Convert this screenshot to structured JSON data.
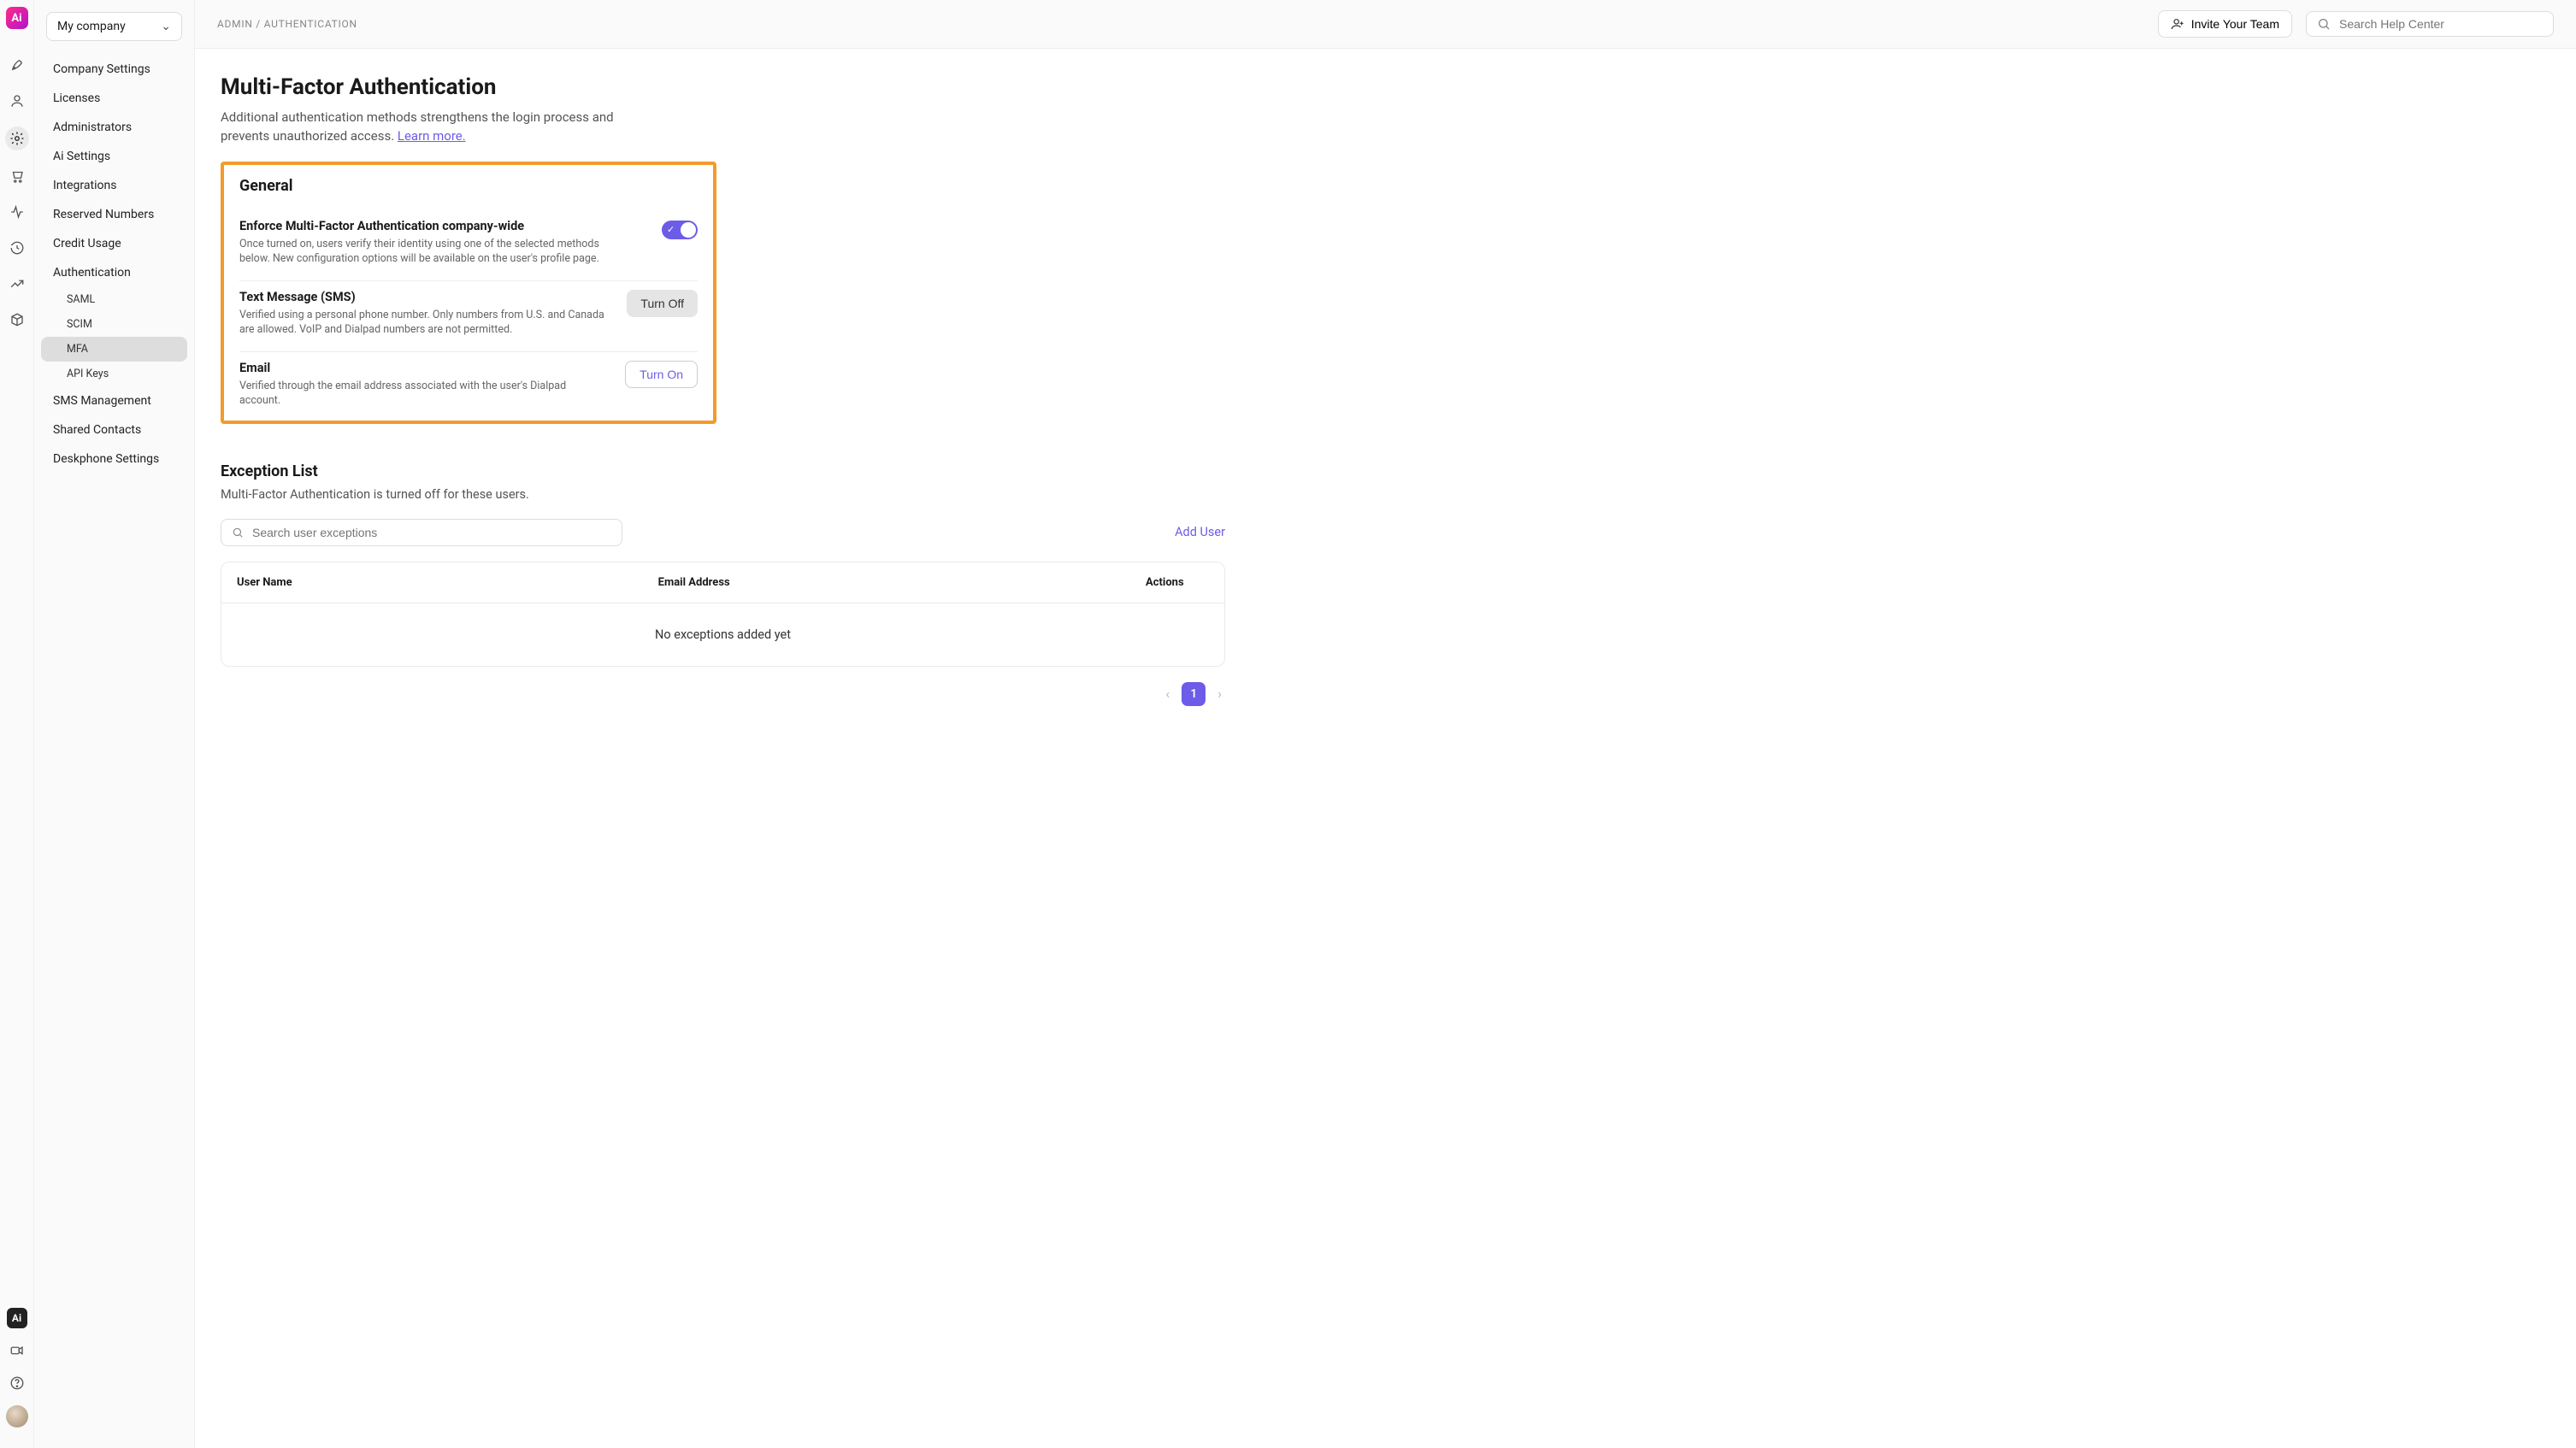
{
  "brand_initial": "Ai",
  "company_selector": {
    "label": "My company"
  },
  "sidebar": {
    "items": [
      "Company Settings",
      "Licenses",
      "Administrators",
      "Ai Settings",
      "Integrations",
      "Reserved Numbers",
      "Credit Usage",
      "Authentication"
    ],
    "auth_sub": [
      "SAML",
      "SCIM",
      "MFA",
      "API Keys"
    ],
    "auth_sub_active": "MFA",
    "items_after": [
      "SMS Management",
      "Shared Contacts",
      "Deskphone Settings"
    ]
  },
  "topbar": {
    "breadcrumb": "ADMIN / AUTHENTICATION",
    "invite_label": "Invite Your Team",
    "search_placeholder": "Search Help Center"
  },
  "page": {
    "title": "Multi-Factor Authentication",
    "description": "Additional authentication methods strengthens the login process and prevents unauthorized access. ",
    "learn_more": "Learn more."
  },
  "general": {
    "heading": "General",
    "enforce": {
      "title": "Enforce Multi-Factor Authentication company-wide",
      "desc": "Once turned on, users verify their identity using one of the selected methods below. New configuration options will be available on the user's profile page.",
      "enabled": true
    },
    "sms": {
      "title": "Text Message (SMS)",
      "desc": "Verified using a personal phone number. Only numbers from U.S. and Canada are allowed. VoIP and Dialpad numbers are not permitted.",
      "button": "Turn Off"
    },
    "email": {
      "title": "Email",
      "desc": "Verified through the email address associated with the user's Dialpad account.",
      "button": "Turn On"
    }
  },
  "exceptions": {
    "heading": "Exception List",
    "description": "Multi-Factor Authentication is turned off for these users.",
    "search_placeholder": "Search user exceptions",
    "add_user": "Add User",
    "columns": {
      "name": "User Name",
      "email": "Email Address",
      "actions": "Actions"
    },
    "empty": "No exceptions added yet",
    "page": "1"
  }
}
